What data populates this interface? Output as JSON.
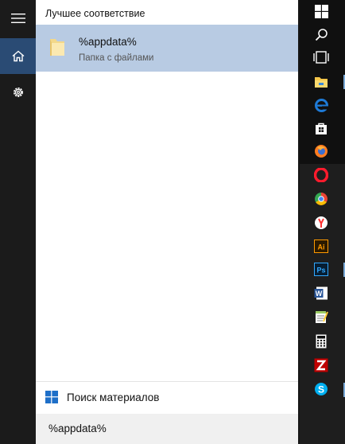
{
  "best_match": {
    "heading": "Лучшее соответствие",
    "title": "%appdata%",
    "subtitle": "Папка с файлами"
  },
  "materials": {
    "label": "Поиск материалов"
  },
  "search": {
    "value": "%appdata%"
  },
  "taskbar": {
    "items": [
      {
        "name": "start-icon"
      },
      {
        "name": "search-icon"
      },
      {
        "name": "task-view-icon"
      },
      {
        "name": "file-explorer-icon",
        "color": "#f6c74b"
      },
      {
        "name": "edge-icon",
        "color": "#1e7ad6"
      },
      {
        "name": "store-icon",
        "color": "#ffffff"
      },
      {
        "name": "firefox-icon",
        "color": "#ff7c1f"
      },
      {
        "name": "opera-icon",
        "color": "#ff1b2d"
      },
      {
        "name": "chrome-icon",
        "color": "#34a853"
      },
      {
        "name": "yandex-browser-icon",
        "color": "#ff3333"
      },
      {
        "name": "illustrator-icon",
        "color": "#ff9a00",
        "glyph": "Ai"
      },
      {
        "name": "photoshop-icon",
        "color": "#31a8ff",
        "glyph": "Ps"
      },
      {
        "name": "word-icon",
        "color": "#2b579a",
        "glyph": "W"
      },
      {
        "name": "notepad-icon",
        "color": "#9ccc65"
      },
      {
        "name": "calculator-icon",
        "color": "#ffffff"
      },
      {
        "name": "filezilla-icon",
        "color": "#bf0000",
        "glyph": "Z"
      },
      {
        "name": "skype-icon",
        "color": "#00aff0",
        "glyph": "S"
      }
    ]
  }
}
